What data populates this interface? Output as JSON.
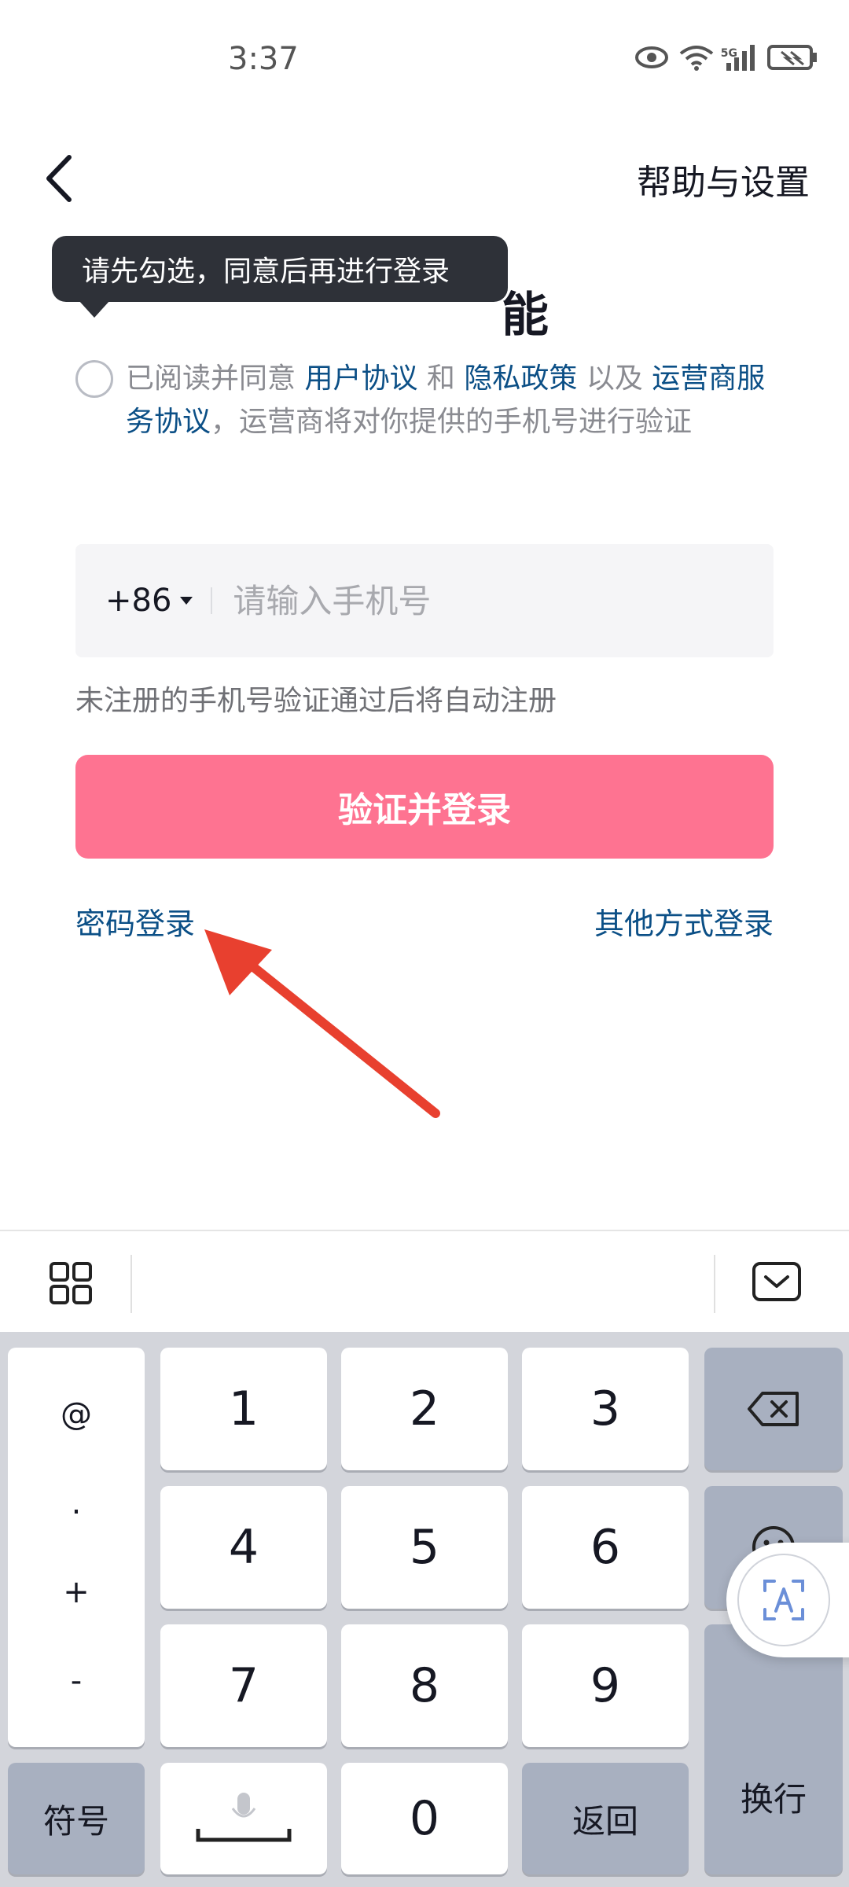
{
  "status_bar": {
    "time": "3:37",
    "network": "5G"
  },
  "header": {
    "help_label": "帮助与设置"
  },
  "title": {
    "visible_text": "能"
  },
  "tooltip": {
    "text": "请先勾选，同意后再进行登录"
  },
  "agreement": {
    "prefix": "已阅读并同意 ",
    "user_agreement": "用户协议",
    "and": " 和 ",
    "privacy_policy": "隐私政策",
    "and_also": " 以及 ",
    "carrier_agreement": "运营商服务协议",
    "suffix": "，运营商将对你提供的手机号进行验证"
  },
  "phone": {
    "country_code": "+86",
    "placeholder": "请输入手机号",
    "value": ""
  },
  "hint": "未注册的手机号验证通过后将自动注册",
  "login_button": "验证并登录",
  "password_login": "密码登录",
  "other_login": "其他方式登录",
  "keyboard": {
    "symbols": [
      "@",
      ".",
      "+",
      "-"
    ],
    "digits": [
      "1",
      "2",
      "3",
      "4",
      "5",
      "6",
      "7",
      "8",
      "9",
      "0"
    ],
    "symbol_key": "符号",
    "return_key": "返回",
    "enter_key": "换行"
  },
  "colors": {
    "accent": "#fe7391",
    "link": "#0b4f86",
    "annotation_arrow": "#e8402f"
  }
}
